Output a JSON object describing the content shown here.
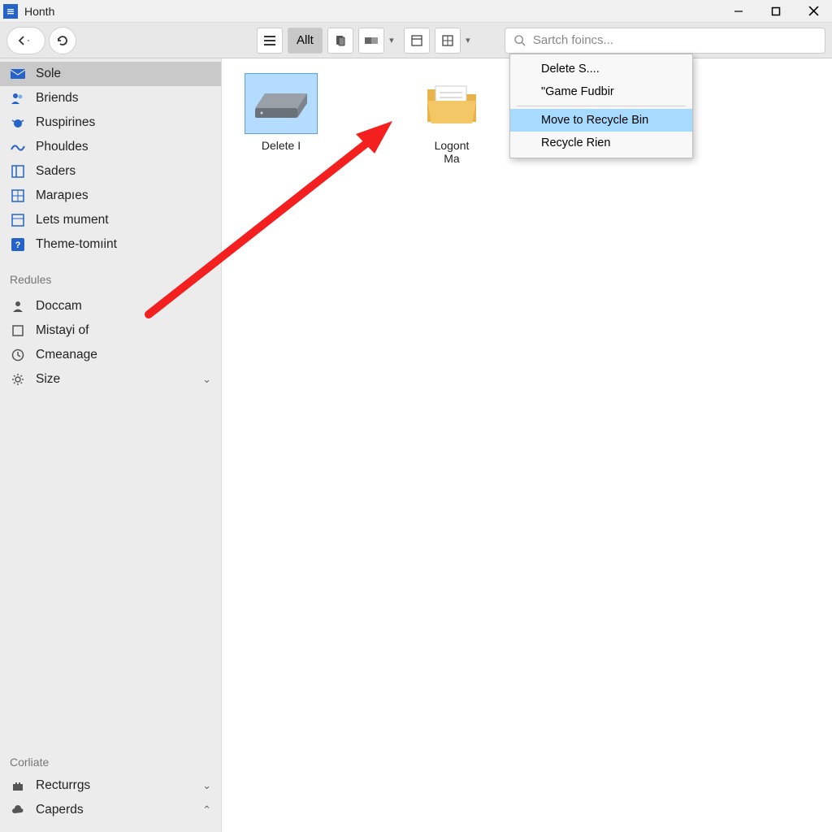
{
  "window": {
    "title": "Honth"
  },
  "toolbar": {
    "allt_label": "Allt",
    "search_placeholder": "Sartch foincs..."
  },
  "sidebar": {
    "primary": [
      {
        "icon": "mail",
        "label": "Sole",
        "selected": true
      },
      {
        "icon": "users",
        "label": "Briends"
      },
      {
        "icon": "bug",
        "label": "Ruspirines"
      },
      {
        "icon": "wave",
        "label": "Phouldes"
      },
      {
        "icon": "panel",
        "label": "Saders"
      },
      {
        "icon": "grid",
        "label": "Marapıes"
      },
      {
        "icon": "panel2",
        "label": "Lets mument"
      },
      {
        "icon": "question",
        "label": "Theme-tomıint"
      }
    ],
    "section_label": "Redules",
    "secondary": [
      {
        "icon": "person",
        "label": "Doccam"
      },
      {
        "icon": "square",
        "label": "Mistayi of"
      },
      {
        "icon": "clock",
        "label": "Cmeanage"
      },
      {
        "icon": "gear",
        "label": "Size",
        "expandable": true
      }
    ],
    "footer_label": "Corliate",
    "footer": [
      {
        "icon": "castle",
        "label": "Recturrgs",
        "expandable": true
      },
      {
        "icon": "cloud",
        "label": "Caperds",
        "expandable_up": true
      }
    ]
  },
  "files": {
    "item0": {
      "label": "Delete I"
    },
    "item1": {
      "label_line1": "Lоgont",
      "label_line2": "Ma"
    }
  },
  "menu": {
    "delete": "Delete S....",
    "game": "\"Game Fudbir",
    "move": "Move to Recycle Bin",
    "recycle": "Recycle Rien"
  }
}
